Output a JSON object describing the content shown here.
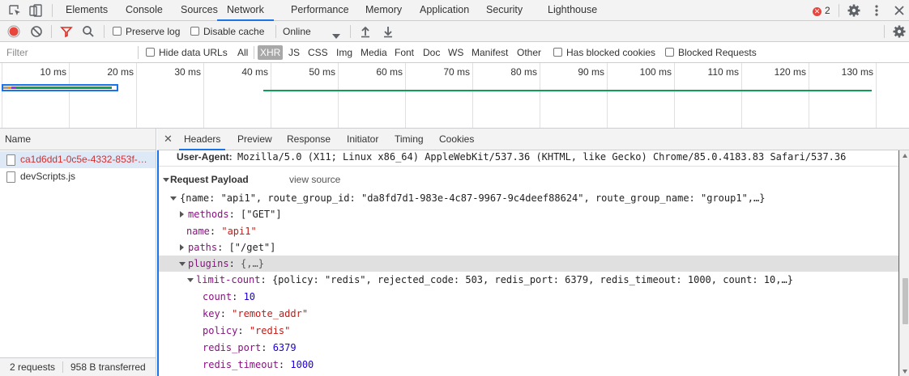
{
  "topbar": {
    "tabs": [
      {
        "label": "Elements",
        "active": false
      },
      {
        "label": "Console",
        "active": false
      },
      {
        "label": "Sources",
        "active": false
      },
      {
        "label": "Network",
        "active": true
      },
      {
        "label": "Performance",
        "active": false
      },
      {
        "label": "Memory",
        "active": false
      },
      {
        "label": "Application",
        "active": false
      },
      {
        "label": "Security",
        "active": false
      },
      {
        "label": "Lighthouse",
        "active": false
      }
    ],
    "error_count": "2",
    "accent_color": "#1a73e8",
    "error_color": "#e8453c"
  },
  "toolbar": {
    "preserve_log": "Preserve log",
    "disable_cache": "Disable cache",
    "throttle": "Online"
  },
  "filterbar": {
    "filter_placeholder": "Filter",
    "hide_data_urls": "Hide data URLs",
    "types": [
      {
        "label": "All",
        "active": false
      },
      {
        "label": "XHR",
        "active": true
      },
      {
        "label": "JS",
        "active": false
      },
      {
        "label": "CSS",
        "active": false
      },
      {
        "label": "Img",
        "active": false
      },
      {
        "label": "Media",
        "active": false
      },
      {
        "label": "Font",
        "active": false
      },
      {
        "label": "Doc",
        "active": false
      },
      {
        "label": "WS",
        "active": false
      },
      {
        "label": "Manifest",
        "active": false
      },
      {
        "label": "Other",
        "active": false
      }
    ],
    "has_blocked_cookies": "Has blocked cookies",
    "blocked_requests": "Blocked Requests"
  },
  "overview": {
    "ticks": [
      "10 ms",
      "20 ms",
      "30 ms",
      "40 ms",
      "50 ms",
      "60 ms",
      "70 ms",
      "80 ms",
      "90 ms",
      "100 ms",
      "110 ms",
      "120 ms",
      "130 ms"
    ]
  },
  "requests": {
    "header": "Name",
    "items": [
      {
        "name": "ca1d6dd1-0c5e-4332-853f-…",
        "selected": true
      },
      {
        "name": "devScripts.js",
        "selected": false
      }
    ],
    "status_requests": "2 requests",
    "status_transferred": "958 B transferred"
  },
  "detail": {
    "tabs": [
      {
        "label": "Headers",
        "active": true
      },
      {
        "label": "Preview",
        "active": false
      },
      {
        "label": "Response",
        "active": false
      },
      {
        "label": "Initiator",
        "active": false
      },
      {
        "label": "Timing",
        "active": false
      },
      {
        "label": "Cookies",
        "active": false
      }
    ],
    "user_agent_key": "User-Agent:",
    "user_agent_value": "Mozilla/5.0 (X11; Linux x86_64) AppleWebKit/537.36 (KHTML, like Gecko) Chrome/85.0.4183.83 Safari/537.36",
    "payload_title": "Request Payload",
    "view_source": "view source",
    "root_summary": "{name: \"api1\", route_group_id: \"da8fd7d1-983e-4c87-9967-9c4deef88624\", route_group_name: \"group1\",…}",
    "methods_key": "methods",
    "methods_val": "[\"GET\"]",
    "name_key": "name",
    "name_val": "\"api1\"",
    "paths_key": "paths",
    "paths_val": "[\"/get\"]",
    "plugins_key": "plugins",
    "plugins_val": "{,…}",
    "limit_key": "limit-count",
    "limit_val": "{policy: \"redis\", rejected_code: 503, redis_port: 6379, redis_timeout: 1000, count: 10,…}",
    "count_key": "count",
    "count_val": "10",
    "keyf_key": "key",
    "keyf_val": "\"remote_addr\"",
    "policy_key": "policy",
    "policy_val": "\"redis\"",
    "redis_port_key": "redis_port",
    "redis_port_val": "6379",
    "redis_timeout_key": "redis_timeout",
    "redis_timeout_val": "1000"
  }
}
